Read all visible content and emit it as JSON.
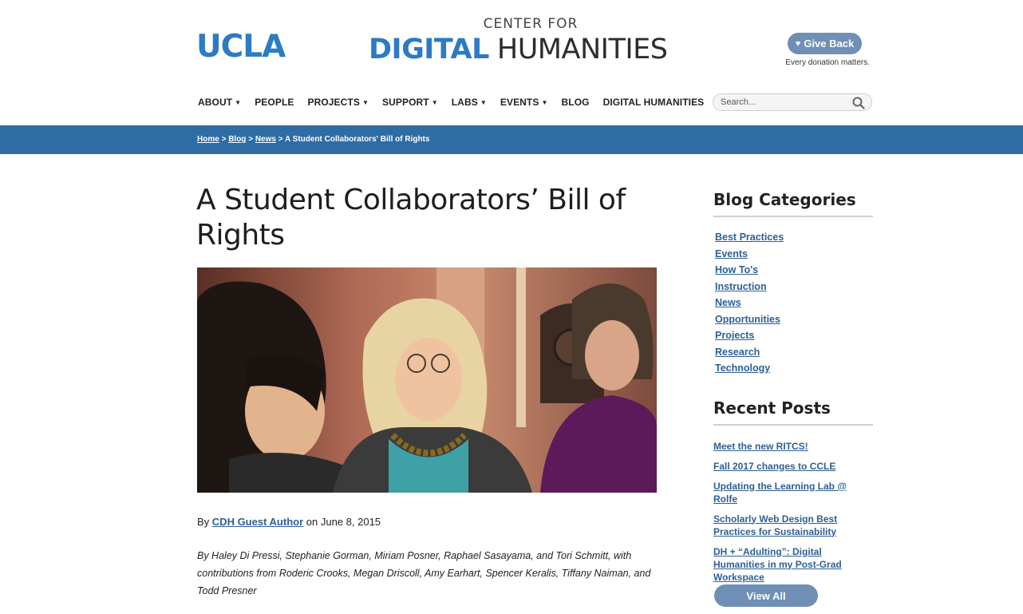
{
  "header": {
    "ucla_logo": "UCLA",
    "cdh_top": "CENTER FOR",
    "cdh_digital": "DIGITAL",
    "cdh_humanities": "HUMANITIES",
    "give_back_label": "Give Back",
    "give_back_icon": "heart-icon",
    "donation_note": "Every donation matters."
  },
  "nav": {
    "items": [
      {
        "label": "ABOUT",
        "dropdown": true
      },
      {
        "label": "PEOPLE",
        "dropdown": false
      },
      {
        "label": "PROJECTS",
        "dropdown": true
      },
      {
        "label": "SUPPORT",
        "dropdown": true
      },
      {
        "label": "LABS",
        "dropdown": true
      },
      {
        "label": "EVENTS",
        "dropdown": true
      },
      {
        "label": "BLOG",
        "dropdown": false
      },
      {
        "label": "DIGITAL HUMANITIES",
        "dropdown": false
      }
    ]
  },
  "search": {
    "placeholder": "Search...",
    "icon": "search-icon"
  },
  "breadcrumb": {
    "home": "Home",
    "blog": "Blog",
    "news": "News",
    "separator": ">",
    "current": "A Student Collaborators' Bill of Rights"
  },
  "article": {
    "title": "A Student Collaborators’ Bill of Rights",
    "byline_prefix": "By",
    "author": "CDH Guest Author",
    "date_text": "on June 8, 2015",
    "authors_note": "By Haley Di Pressi, Stephanie Gorman, Miriam Posner, Raphael Sasayama, and Tori Schmitt, with contributions from Roderic Crooks, Megan Driscoll, Amy Earhart, Spencer Keralis, Tiffany Naiman, and Todd Presner"
  },
  "sidebar": {
    "categories_heading": "Blog Categories",
    "categories": [
      "Best Practices",
      "Events",
      "How To's",
      "Instruction",
      "News",
      "Opportunities",
      "Projects",
      "Research",
      "Technology"
    ],
    "recent_heading": "Recent Posts",
    "recent_posts": [
      "Meet the new RITCS!",
      "Fall 2017 changes to CCLE",
      "Updating the Learning Lab @ Rolfe",
      "Scholarly Web Design Best Practices for Sustainability",
      "DH + “Adulting”: Digital Humanities in my Post-Grad Workspace"
    ],
    "view_all_label": "View All"
  },
  "colors": {
    "brand_blue": "#2d7bc1",
    "breadcrumb_bar": "#2e6ca4",
    "link": "#2e5f95",
    "button": "#6f8fb6"
  }
}
